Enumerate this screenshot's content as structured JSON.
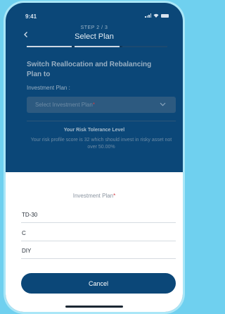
{
  "status_bar": {
    "time": "9:41"
  },
  "header": {
    "step": "STEP 2 / 3",
    "title": "Select Plan"
  },
  "progress": {
    "current_step": 2,
    "total_steps": 3
  },
  "form": {
    "section_title": "Switch Reallocation and Rebalancing Plan to",
    "plan_label": "Investment Plan :",
    "plan_placeholder": "Select Investment Plan",
    "required_mark": "*"
  },
  "risk": {
    "title": "Your Risk Tolerance Level",
    "text": "Your risk profile score is 32 which should invest in risky asset not over 50.00%"
  },
  "sheet": {
    "title": "Investment Plan",
    "required_mark": "*",
    "options": [
      "TD-30",
      "C",
      "DIY"
    ],
    "cancel_label": "Cancel"
  },
  "colors": {
    "primary": "#0b4778",
    "required": "#d13a42",
    "background": "#6fd0ef"
  },
  "icons": [
    "back-icon",
    "chevron-down-icon",
    "signal-icon",
    "wifi-icon",
    "battery-icon"
  ]
}
